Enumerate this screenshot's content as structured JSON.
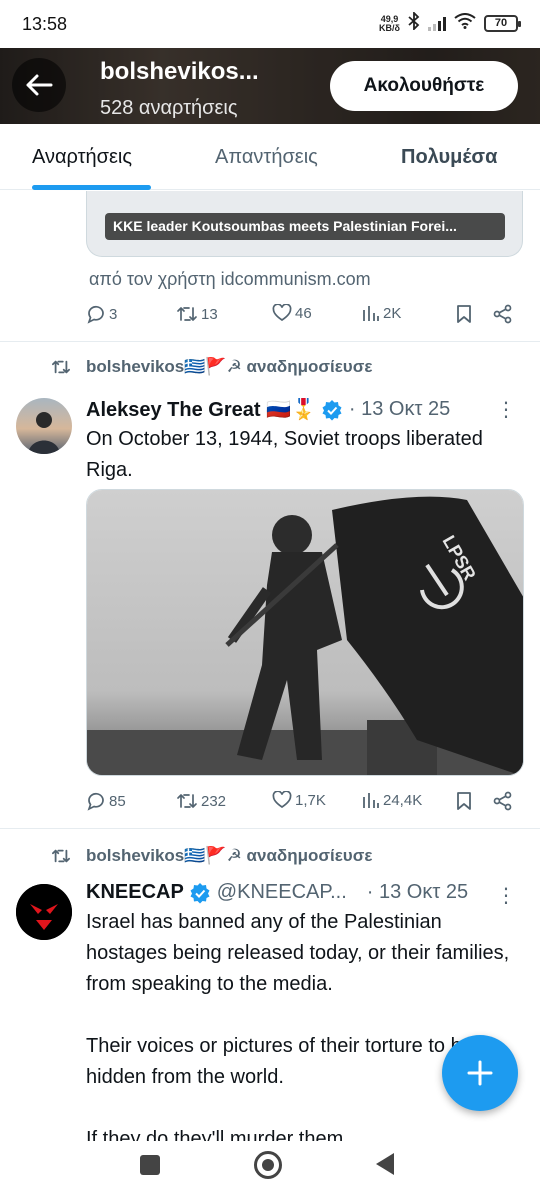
{
  "status_bar": {
    "time": "13:58",
    "net_speed_value": "49,9",
    "net_speed_unit": "KB/δ",
    "battery": "70"
  },
  "header": {
    "title": "bolshevikos...",
    "subtitle": "528 αναρτήσεις",
    "follow_label": "Ακολουθήστε"
  },
  "tabs": [
    {
      "label": "Αναρτήσεις",
      "active": true
    },
    {
      "label": "Απαντήσεις",
      "active": false
    },
    {
      "label": "Πολυμέσα",
      "active": false
    }
  ],
  "post0": {
    "card_title": "KKE leader Koutsoumbas meets Palestinian Forei...",
    "from": "από τον χρήστη idcommunism.com",
    "replies": "3",
    "reposts": "13",
    "likes": "46",
    "views": "2K"
  },
  "post1": {
    "reposted_by": "bolshevikos🇬🇷🚩☭ αναδημοσίευσε",
    "author": "Aleksey The Great 🇷🇺🎖️",
    "date": "· 13 Οκτ 25",
    "text": "On October 13, 1944, Soviet troops liberated Riga.",
    "flag_text": "LPSR",
    "replies": "85",
    "reposts": "232",
    "likes": "1,7K",
    "views": "24,4K"
  },
  "post2": {
    "reposted_by": "bolshevikos🇬🇷🚩☭ αναδημοσίευσε",
    "author": "KNEECAP",
    "handle": "@KNEECAP...",
    "date": "· 13 Οκτ 25",
    "text": "Israel has banned any of the Palestinian hostages being released today, or their families, from speaking to the media.\n\nTheir voices or pictures of their torture to be hidden from the world.\n\nIf they do they'll murder them."
  },
  "colors": {
    "accent": "#1d9bf0",
    "muted": "#536471",
    "verified": "#1d9bf0"
  }
}
